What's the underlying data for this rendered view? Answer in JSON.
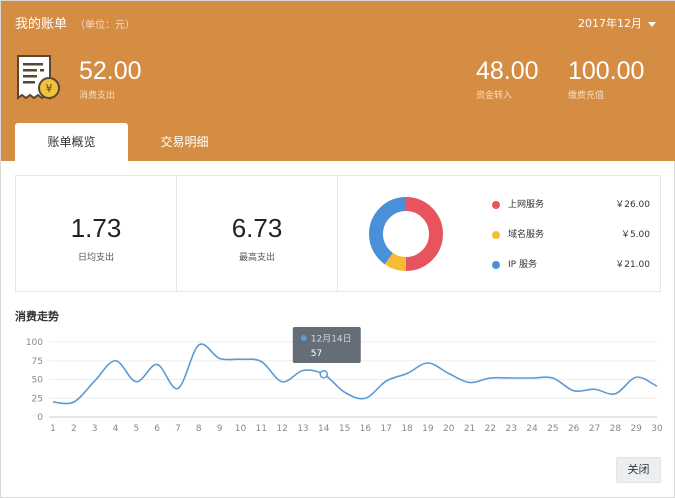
{
  "header": {
    "title": "我的账单",
    "unit": "（单位：元）",
    "month": "2017年12月",
    "spend": {
      "value": "52.00",
      "label": "消费支出"
    },
    "transfer": {
      "value": "48.00",
      "label": "资金转入"
    },
    "recharge": {
      "value": "100.00",
      "label": "缴费充值"
    },
    "tabs": [
      "账单概览",
      "交易明细"
    ]
  },
  "summary": {
    "daily_avg": {
      "value": "1.73",
      "label": "日均支出"
    },
    "max": {
      "value": "6.73",
      "label": "最高支出"
    }
  },
  "breakdown": [
    {
      "name": "上网服务",
      "value": "￥26.00",
      "amount": 26,
      "color": "#e8545d"
    },
    {
      "name": "域名服务",
      "value": "￥5.00",
      "amount": 5,
      "color": "#f5bb33"
    },
    {
      "name": "IP 服务",
      "value": "￥21.00",
      "amount": 21,
      "color": "#4a90d9"
    }
  ],
  "trend": {
    "title": "消费走势",
    "tooltip": {
      "date": "12月14日",
      "value": "57"
    },
    "close_label": "关闭"
  },
  "chart_data": {
    "type": "line",
    "x": [
      1,
      2,
      3,
      4,
      5,
      6,
      7,
      8,
      9,
      10,
      11,
      12,
      13,
      14,
      15,
      16,
      17,
      18,
      19,
      20,
      21,
      22,
      23,
      24,
      25,
      26,
      27,
      28,
      29,
      30
    ],
    "series": [
      {
        "values": [
          20,
          20,
          48,
          75,
          47,
          70,
          38,
          96,
          78,
          77,
          74,
          47,
          62,
          57,
          33,
          25,
          48,
          58,
          72,
          58,
          46,
          52,
          52,
          52,
          52,
          35,
          37,
          31,
          53,
          41
        ]
      }
    ],
    "y_ticks": [
      0,
      25,
      50,
      75,
      100
    ],
    "ylim": [
      0,
      100
    ],
    "highlight_x": 14,
    "line_color": "#5b9bd5"
  }
}
